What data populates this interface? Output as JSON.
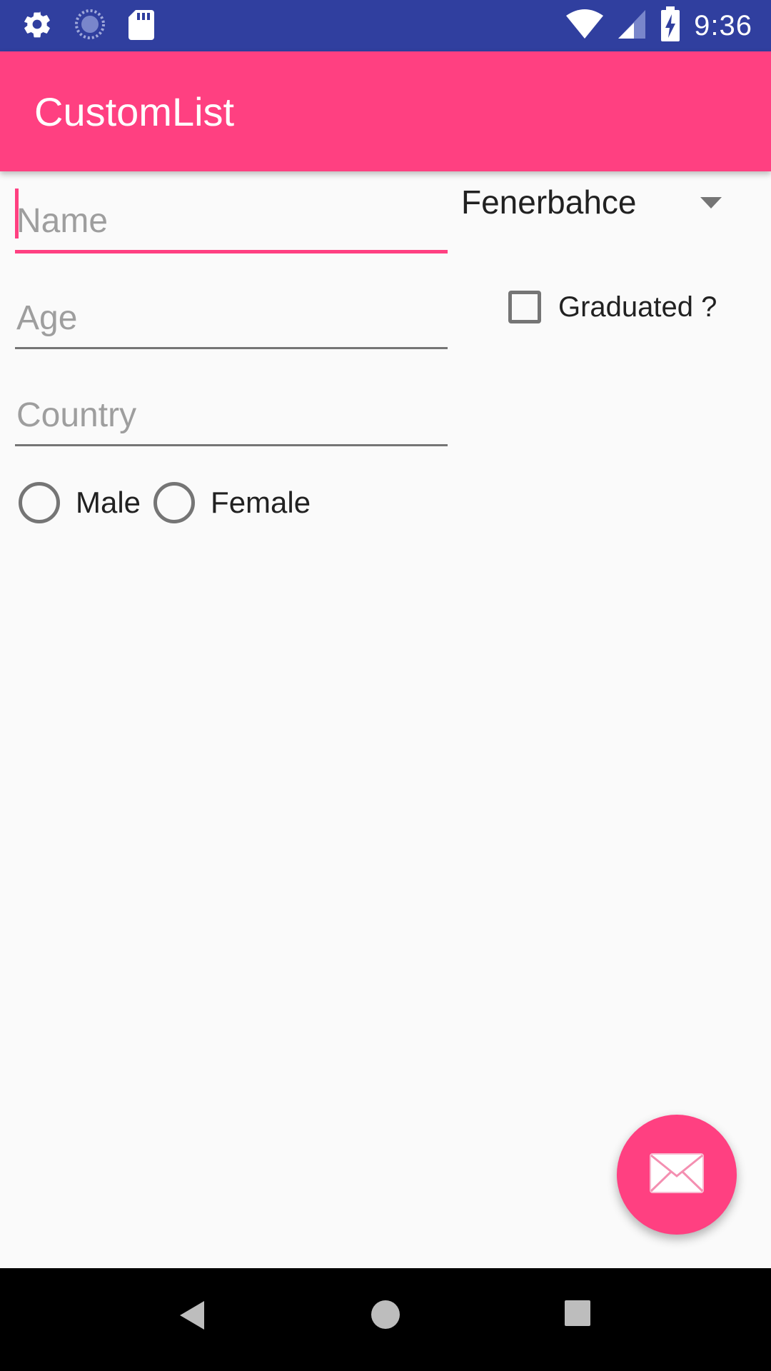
{
  "status_bar": {
    "time": "9:36",
    "left_icons": [
      "gear-icon",
      "sync-icon",
      "sd-card-icon"
    ],
    "right_icons": [
      "wifi-icon",
      "signal-icon",
      "battery-charging-icon"
    ]
  },
  "app_bar": {
    "title": "CustomList",
    "color": "#ff4081"
  },
  "form": {
    "name_placeholder": "Name",
    "age_placeholder": "Age",
    "country_placeholder": "Country",
    "spinner_value": "Fenerbahce",
    "checkbox_label": "Graduated ?",
    "radio_male_label": "Male",
    "radio_female_label": "Female"
  },
  "fab": {
    "icon": "envelope-icon"
  },
  "nav_bar": {
    "icons": [
      "back-icon",
      "home-icon",
      "recents-icon"
    ]
  },
  "colors": {
    "status_bar": "#303f9f",
    "accent": "#ff4081",
    "background": "#fafafa"
  }
}
